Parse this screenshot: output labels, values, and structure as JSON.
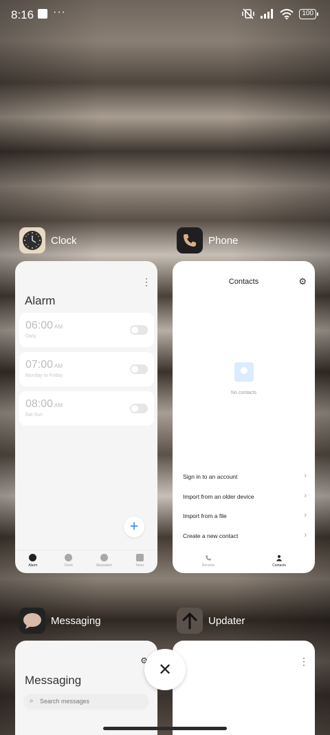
{
  "status_bar": {
    "time": "8:16",
    "dots": "···",
    "battery": "100"
  },
  "apps": {
    "clock": {
      "name": "Clock",
      "screen_title": "Alarm",
      "alarms": [
        {
          "time": "06:00",
          "ampm": "AM",
          "repeat": "Daily"
        },
        {
          "time": "07:00",
          "ampm": "AM",
          "repeat": "Monday to Friday"
        },
        {
          "time": "08:00",
          "ampm": "AM",
          "repeat": "Sat Sun"
        }
      ],
      "fab": "+",
      "tabs": [
        "Alarm",
        "Clock",
        "Stopwatch",
        "Timer"
      ]
    },
    "phone": {
      "name": "Phone",
      "screen_title": "Contacts",
      "empty_text": "No contacts",
      "actions": [
        "Sign in to an account",
        "Import from an older device",
        "Import from a file",
        "Create a new contact"
      ],
      "tabs": [
        "Recents",
        "Contacts"
      ]
    },
    "messaging": {
      "name": "Messaging",
      "screen_title": "Messaging",
      "search_placeholder": "Search messages"
    },
    "updater": {
      "name": "Updater"
    }
  },
  "controls": {
    "close_glyph": "✕"
  },
  "colors": {
    "accent": "#2e86ff",
    "card": "#f5f5f5"
  }
}
